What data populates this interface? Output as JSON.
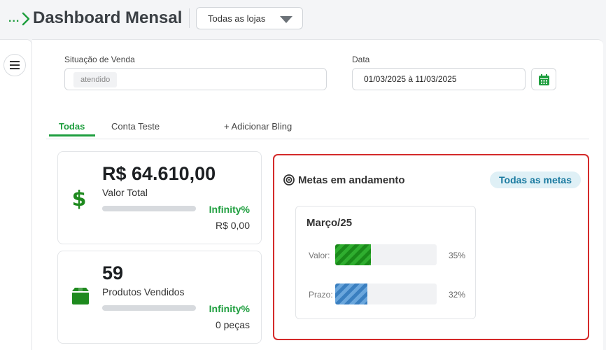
{
  "header": {
    "breadcrumb_dots": "...",
    "title": "Dashboard Mensal",
    "store_select": "Todas as lojas"
  },
  "filters": {
    "status_label": "Situação de Venda",
    "status_chip": "atendido",
    "date_label": "Data",
    "date_value": "01/03/2025 à 11/03/2025"
  },
  "tabs": [
    {
      "label": "Todas",
      "active": true
    },
    {
      "label": "Conta Teste",
      "active": false
    },
    {
      "label": "+ Adicionar Bling",
      "active": false
    }
  ],
  "kpis": [
    {
      "value": "R$ 64.610,00",
      "label": "Valor Total",
      "percent": "Infinity%",
      "sub": "R$ 0,00",
      "icon": "dollar-icon",
      "progress": 0
    },
    {
      "value": "59",
      "label": "Produtos Vendidos",
      "percent": "Infinity%",
      "sub": "0 peças",
      "icon": "box-icon",
      "progress": 0
    }
  ],
  "goals": {
    "title": "Metas em andamento",
    "all_button": "Todas as metas",
    "month": {
      "title": "Março/25",
      "rows": [
        {
          "label": "Valor:",
          "percent": "35%",
          "value": 35,
          "color": "#1a8a1a"
        },
        {
          "label": "Prazo:",
          "percent": "32%",
          "value": 32,
          "color": "#3a7fc0"
        }
      ]
    }
  },
  "colors": {
    "accent": "#1e9e3e",
    "highlight_border": "#d42a2a",
    "badge_bg": "#dff0f6"
  }
}
